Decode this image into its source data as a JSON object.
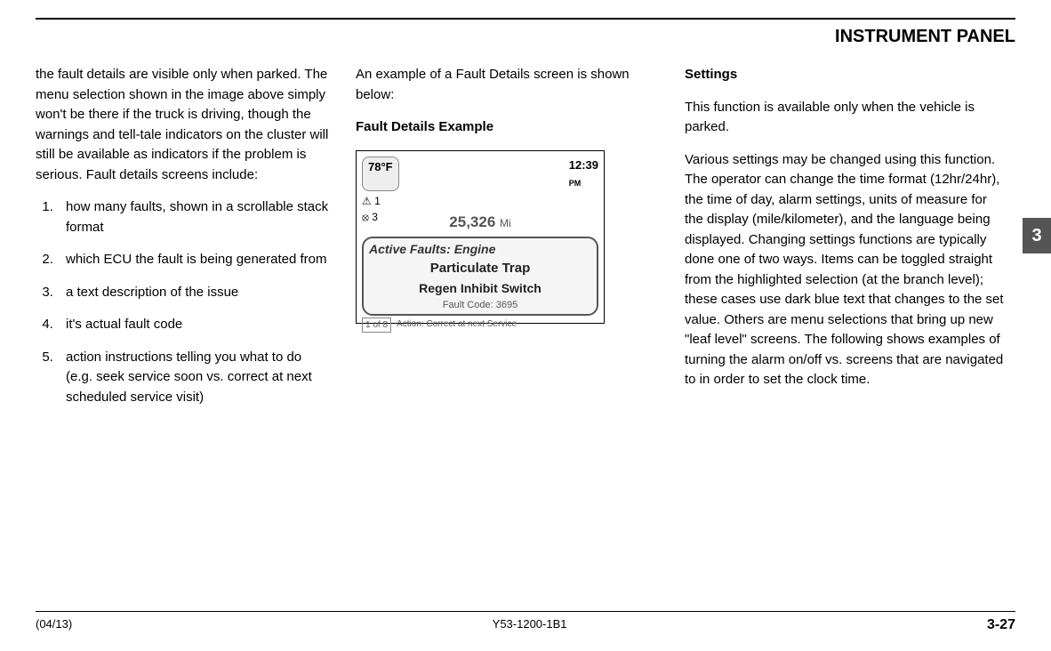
{
  "header": {
    "title": "INSTRUMENT PANEL"
  },
  "col1": {
    "intro": "the fault details are visible only when parked. The menu selection shown in the image above simply won't be there if the truck is driving, though the warnings and tell-tale indicators on the cluster will still be available as indicators if the problem is serious. Fault details screens include:",
    "items": [
      "how many faults, shown in a scrollable stack format",
      "which ECU the fault is being generated from",
      "a text description of the issue",
      "it's actual fault code",
      "action instructions telling you what to do (e.g. seek service soon vs. correct at next scheduled service visit)"
    ]
  },
  "col2": {
    "intro": "An example of a Fault Details screen is shown below:",
    "heading": "Fault Details Example",
    "screen": {
      "temp": "78°F",
      "time": "12:39",
      "time_ampm": "PM",
      "icon1": "⚠ 1",
      "icon2": "⦻ 3",
      "miles": "25,326",
      "miles_unit": "Mi",
      "box_title": "Active Faults:  Engine",
      "box_main": "Particulate Trap",
      "box_sub": "Regen Inhibit Switch",
      "box_code": "Fault Code:  3695",
      "pager": "1 of 8",
      "action": "Action: Correct at next Service"
    }
  },
  "col3": {
    "heading": "Settings",
    "p1": "This function is available only when the vehicle is parked.",
    "p2": "Various settings may be changed using this function. The operator can change the time format (12hr/24hr), the time of day, alarm settings, units of measure for the display (mile/kilometer), and the language being displayed. Changing settings functions are typically done one of two ways. Items can be toggled straight from the highlighted selection (at the branch level); these cases use dark blue text that changes to the set value. Others are menu selections that bring up new \"leaf level\" screens. The following shows examples of turning the alarm on/off vs. screens that are navigated to in order to set the clock time."
  },
  "sideTab": "3",
  "footer": {
    "left": "(04/13)",
    "center": "Y53-1200-1B1",
    "right": "3-27"
  }
}
